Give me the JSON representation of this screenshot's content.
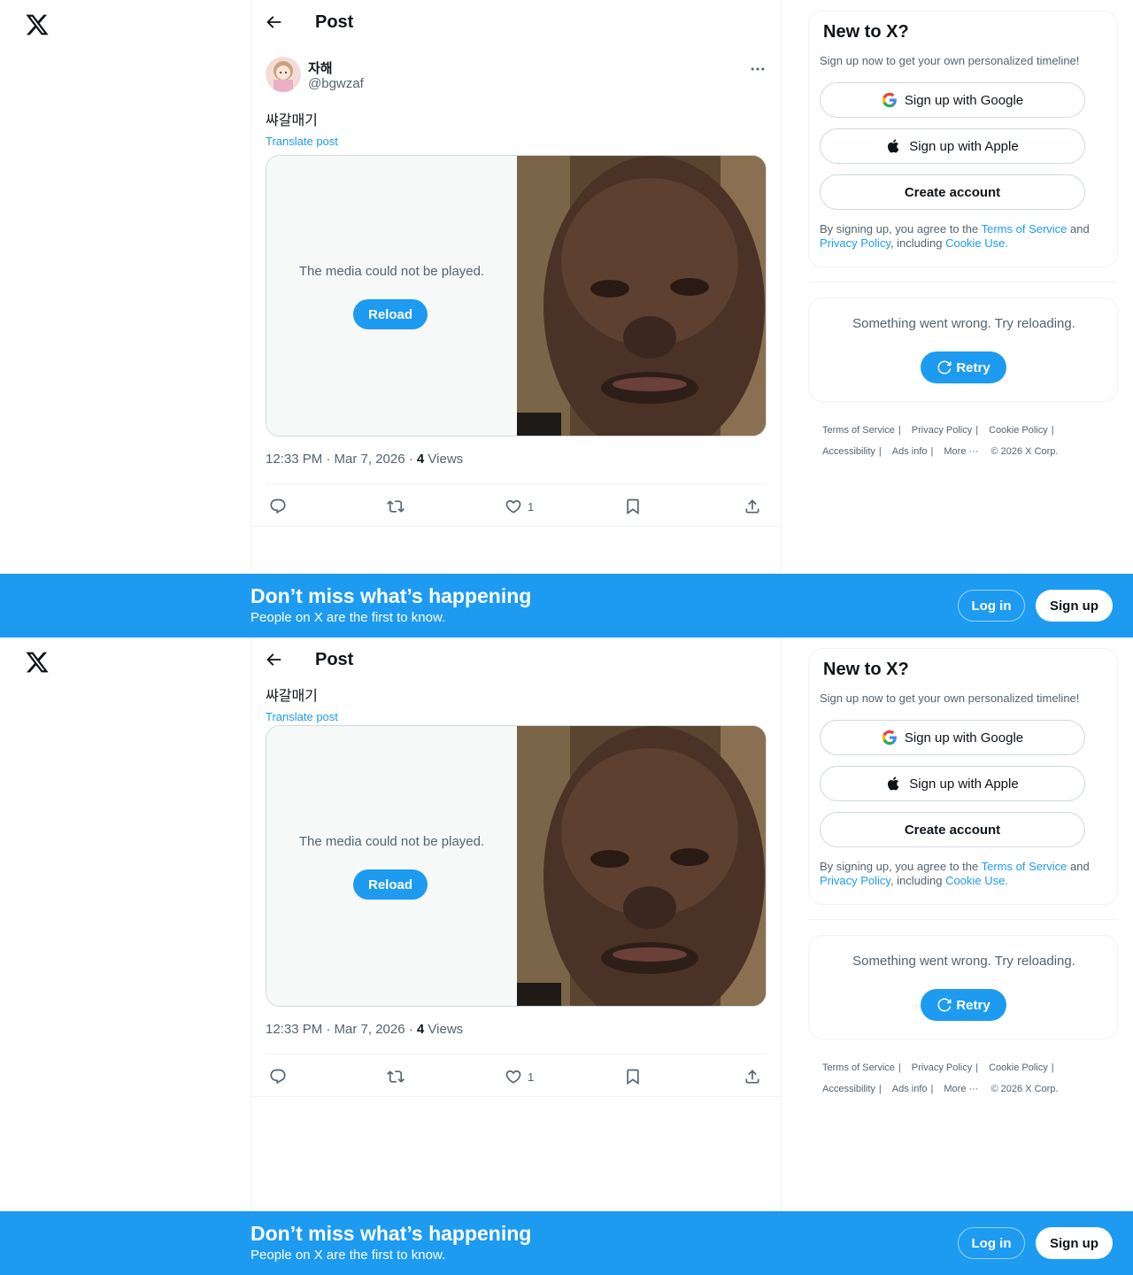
{
  "header": {
    "title": "Post"
  },
  "post": {
    "display_name": "자해",
    "handle": "@bgwzaf",
    "text": "쌰갈매기",
    "translate_label": "Translate post",
    "media_error": "The media could not be played.",
    "reload_label": "Reload",
    "time": "12:33 PM · Mar 7, 2026 · ",
    "views_count": "4",
    "views_label": " Views",
    "likes_count": "1"
  },
  "signup": {
    "title": "New to X?",
    "subtitle": "Sign up now to get your own personalized timeline!",
    "google_label": "Sign up with Google",
    "apple_label": "Sign up with Apple",
    "create_label": "Create account",
    "legal_prefix": "By signing up, you agree to the ",
    "terms": "Terms of Service",
    "and": " and ",
    "privacy": "Privacy Policy",
    "including": ", including ",
    "cookie": "Cookie Use."
  },
  "trends_error": {
    "text": "Something went wrong. Try reloading.",
    "retry_label": "Retry"
  },
  "footer": {
    "terms": "Terms of Service",
    "privacy": "Privacy Policy",
    "cookie": "Cookie Policy",
    "accessibility": "Accessibility",
    "ads": "Ads info",
    "more": "More ···",
    "copyright": "© 2026 X Corp."
  },
  "banner": {
    "title": "Don’t miss what’s happening",
    "subtitle": "People on X are the first to know.",
    "login_label": "Log in",
    "signup_label": "Sign up"
  },
  "colors": {
    "accent": "#1d9bf0",
    "text": "#0f1419",
    "muted": "#536471"
  }
}
